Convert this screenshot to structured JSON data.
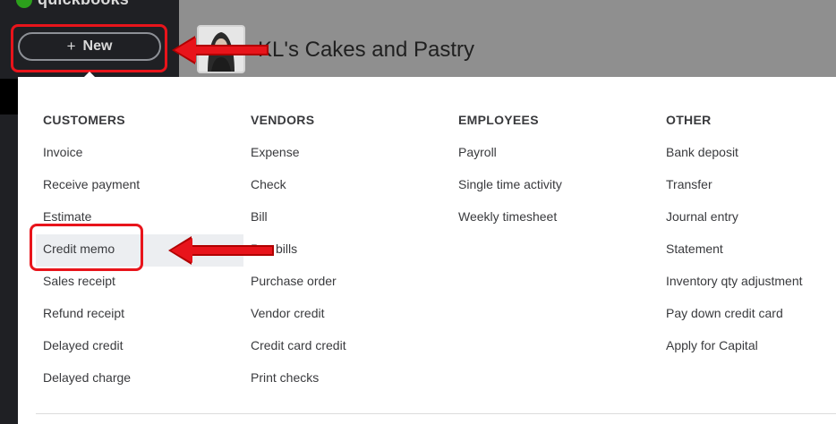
{
  "sidebar": {
    "logo_text": "quickbooks",
    "new_button_label": "New",
    "new_button_icon": "plus-icon"
  },
  "header": {
    "company_name": "KL's Cakes and Pastry"
  },
  "menu": {
    "columns": [
      {
        "heading": "CUSTOMERS",
        "items": [
          "Invoice",
          "Receive payment",
          "Estimate",
          "Credit memo",
          "Sales receipt",
          "Refund receipt",
          "Delayed credit",
          "Delayed charge"
        ]
      },
      {
        "heading": "VENDORS",
        "items": [
          "Expense",
          "Check",
          "Bill",
          "Pay bills",
          "Purchase order",
          "Vendor credit",
          "Credit card credit",
          "Print checks"
        ]
      },
      {
        "heading": "EMPLOYEES",
        "items": [
          "Payroll",
          "Single time activity",
          "Weekly timesheet"
        ]
      },
      {
        "heading": "OTHER",
        "items": [
          "Bank deposit",
          "Transfer",
          "Journal entry",
          "Statement",
          "Inventory qty adjustment",
          "Pay down credit card",
          "Apply for Capital"
        ]
      }
    ],
    "highlighted_item": "Credit memo"
  },
  "annotations": {
    "callout_color": "#e8141b"
  }
}
